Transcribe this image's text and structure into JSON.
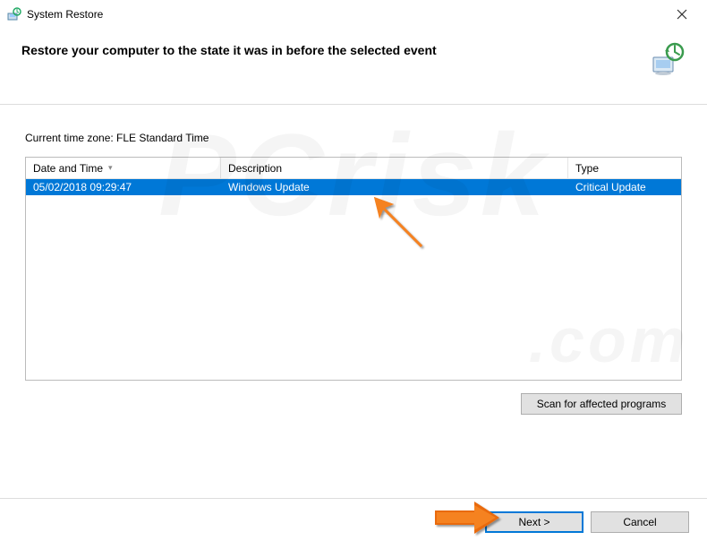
{
  "titlebar": {
    "title": "System Restore"
  },
  "header": {
    "text": "Restore your computer to the state it was in before the selected event"
  },
  "timezone": {
    "label": "Current time zone: FLE Standard Time"
  },
  "table": {
    "headers": {
      "date": "Date and Time",
      "desc": "Description",
      "type": "Type"
    },
    "rows": [
      {
        "date": "05/02/2018 09:29:47",
        "desc": "Windows Update",
        "type": "Critical Update"
      }
    ]
  },
  "buttons": {
    "scan": "Scan for affected programs",
    "next": "Next >",
    "cancel": "Cancel"
  }
}
